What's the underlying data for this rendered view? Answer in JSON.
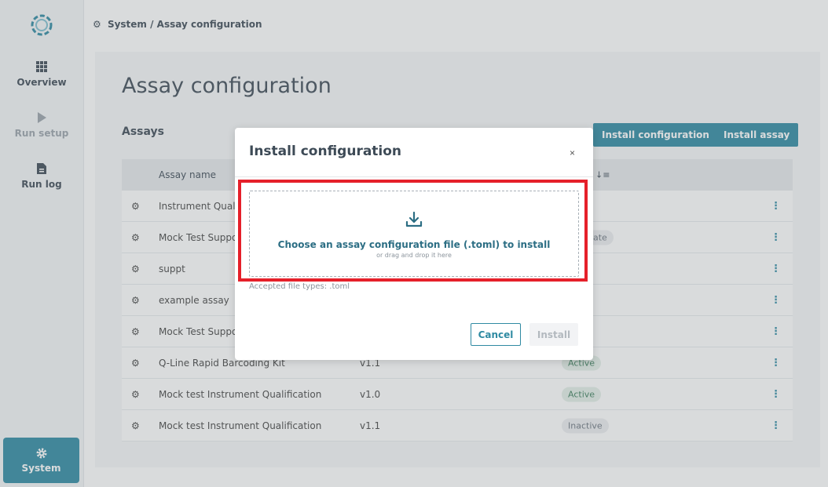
{
  "breadcrumb": "System / Assay configuration",
  "sidebar": {
    "items": [
      {
        "label": "Overview",
        "icon": "grid-icon"
      },
      {
        "label": "Run setup",
        "icon": "play-icon"
      },
      {
        "label": "Run log",
        "icon": "document-icon"
      },
      {
        "label": "System",
        "icon": "gear-icon"
      }
    ]
  },
  "page": {
    "title": "Assay configuration",
    "assays_title": "Assays",
    "install_configuration_label": "Install configuration",
    "install_assay_label": "Install assay"
  },
  "table": {
    "columns": [
      "Assay name"
    ],
    "rows": [
      {
        "name": "Instrument Qual",
        "version": "",
        "status": ""
      },
      {
        "name": "Mock Test Suppo",
        "version": "",
        "status": "ate"
      },
      {
        "name": "suppt",
        "version": "",
        "status": ""
      },
      {
        "name": "example assay",
        "version": "",
        "status": ""
      },
      {
        "name": "Mock Test Suppo",
        "version": "",
        "status": ""
      },
      {
        "name": "Q-Line Rapid Barcoding Kit",
        "version": "v1.1",
        "status": "Active"
      },
      {
        "name": "Mock test Instrument Qualification",
        "version": "v1.0",
        "status": "Active"
      },
      {
        "name": "Mock test Instrument Qualification",
        "version": "v1.1",
        "status": "Inactive"
      }
    ]
  },
  "modal": {
    "title": "Install configuration",
    "close": "×",
    "dropzone_main": "Choose an assay configuration file (.toml) to install",
    "dropzone_sub": "or drag and drop it here",
    "accepted": "Accepted file types: .toml",
    "cancel_label": "Cancel",
    "install_label": "Install"
  },
  "colors": {
    "accent": "#2f8aa2",
    "highlight": "#e5202a"
  }
}
